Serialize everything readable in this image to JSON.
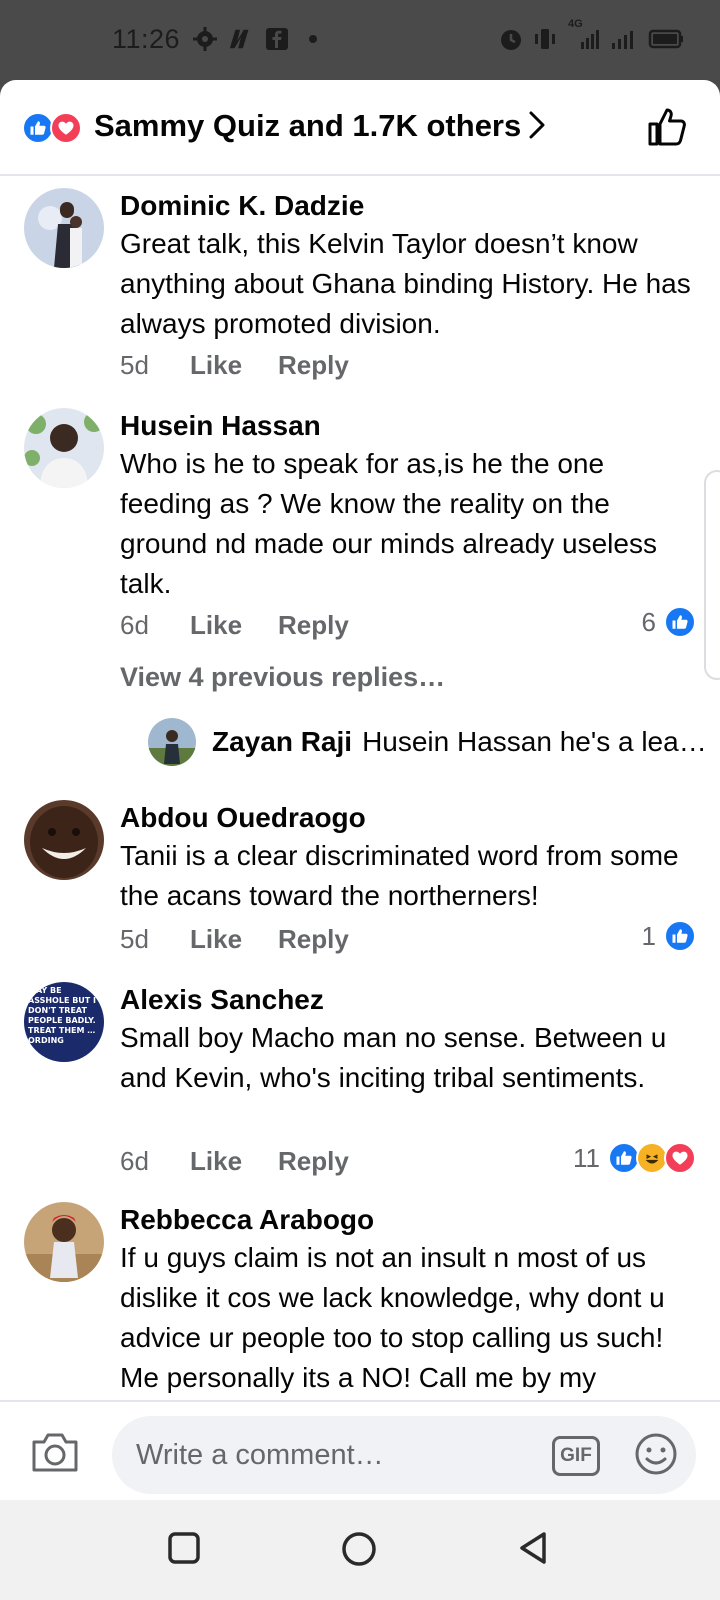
{
  "status_bar": {
    "time": "11:26",
    "network": "4G"
  },
  "header": {
    "reactions_text": "Sammy Quiz and 1.7K others"
  },
  "comments": [
    {
      "name": "Dominic K. Dadzie",
      "text": "Great talk, this Kelvin Taylor doesn’t know anything about Ghana binding History. He has always promoted division.",
      "age": "5d",
      "like_label": "Like",
      "reply_label": "Reply"
    },
    {
      "name": "Husein Hassan",
      "text": "Who is he to speak for as,is he the one feeding as ? We know the reality on the ground nd made our minds already useless talk.",
      "age": "6d",
      "like_label": "Like",
      "reply_label": "Reply",
      "reaction_count": "6",
      "view_replies": "View 4 previous replies…",
      "reply_preview": {
        "name": "Zayan Raji",
        "text": "Husein Hassan he's a lea…"
      }
    },
    {
      "name": "Abdou Ouedraogo",
      "text": "Tanii is a clear discriminated word from some the acans toward the northerners!",
      "age": "5d",
      "like_label": "Like",
      "reply_label": "Reply",
      "reaction_count": "1"
    },
    {
      "name": "Alexis Sanchez",
      "text": "Small boy Macho man no sense. Between u and Kevin, who's inciting tribal sentiments.",
      "age": "6d",
      "like_label": "Like",
      "reply_label": "Reply",
      "reaction_count": "11",
      "avatar_text": "…AY BE ASSHOLE BUT I DON'T TREAT PEOPLE BADLY. TREAT THEM …ORDING"
    },
    {
      "name": "Rebbecca Arabogo",
      "text": "If u guys claim is not an insult n most of us dislike it cos we lack knowledge, why dont u advice ur people too to stop calling us such! Me personally its a NO! Call me by my"
    }
  ],
  "composer": {
    "placeholder": "Write a comment…",
    "gif_label": "GIF"
  },
  "colors": {
    "like_blue": "#1877f2",
    "love_red": "#f33e58",
    "haha_yellow": "#f7b125",
    "meta_gray": "#65676b"
  }
}
